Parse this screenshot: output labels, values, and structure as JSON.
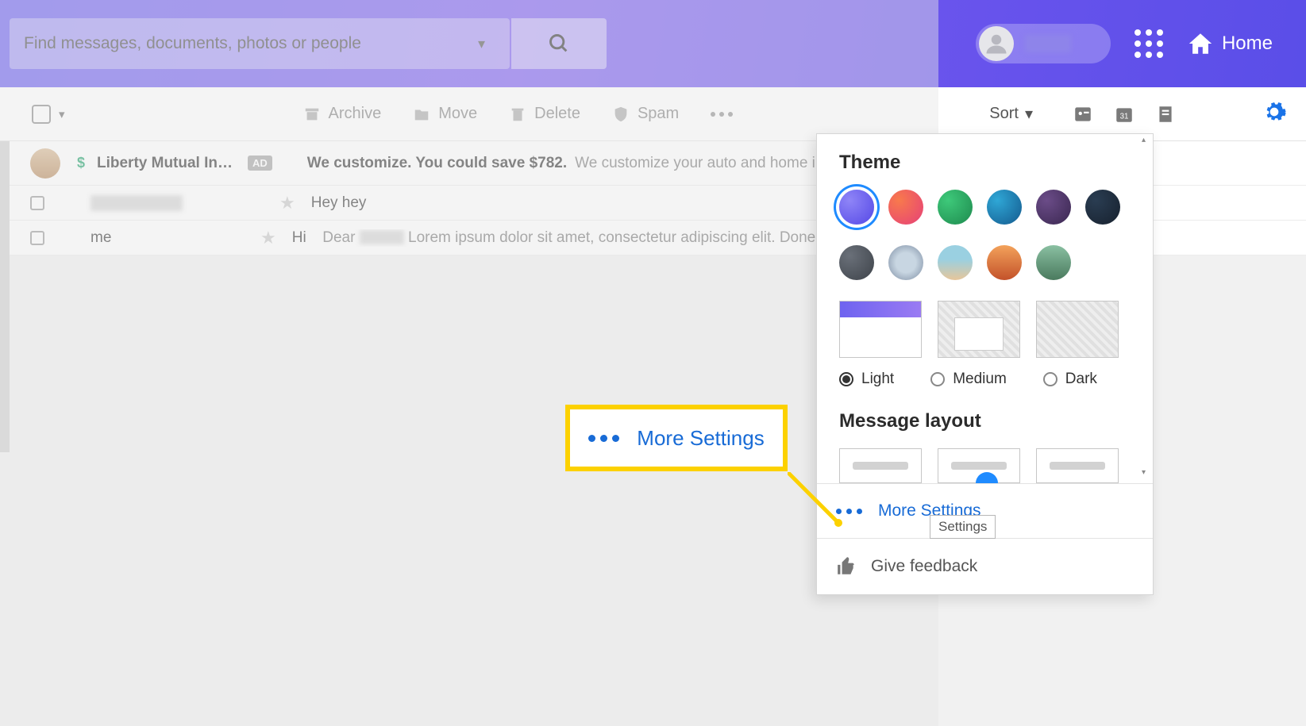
{
  "search": {
    "placeholder": "Find messages, documents, photos or people"
  },
  "header": {
    "home": "Home"
  },
  "toolbar": {
    "archive": "Archive",
    "move": "Move",
    "delete": "Delete",
    "spam": "Spam",
    "sort": "Sort"
  },
  "messages": {
    "ad": {
      "sender": "Liberty Mutual Insu…",
      "badge": "AD",
      "subject": "We customize. You could save $782.",
      "preview": "We customize your auto and home insurance"
    },
    "rows": [
      {
        "sender_hidden": true,
        "subject": "Hey hey",
        "preview": ""
      },
      {
        "sender": "me",
        "subject": "Hi",
        "preview_prefix": "Dear",
        "preview_suffix": "Lorem ipsum dolor sit amet, consectetur adipiscing elit. Done…"
      }
    ]
  },
  "settings": {
    "theme_title": "Theme",
    "swatches_row1": [
      "#7a6ff2",
      "#f1572b",
      "#23a85e",
      "#1f7abf",
      "#5a3c7e",
      "#1e3247"
    ],
    "swatches_row2": [
      "#545964",
      "mountain",
      "beach",
      "sunset",
      "forest"
    ],
    "modes": {
      "light": "Light",
      "medium": "Medium",
      "dark": "Dark",
      "selected": "light"
    },
    "layout_title": "Message layout",
    "more_settings": "More Settings",
    "feedback": "Give feedback",
    "tooltip": "Settings"
  },
  "callout": {
    "label": "More Settings"
  }
}
